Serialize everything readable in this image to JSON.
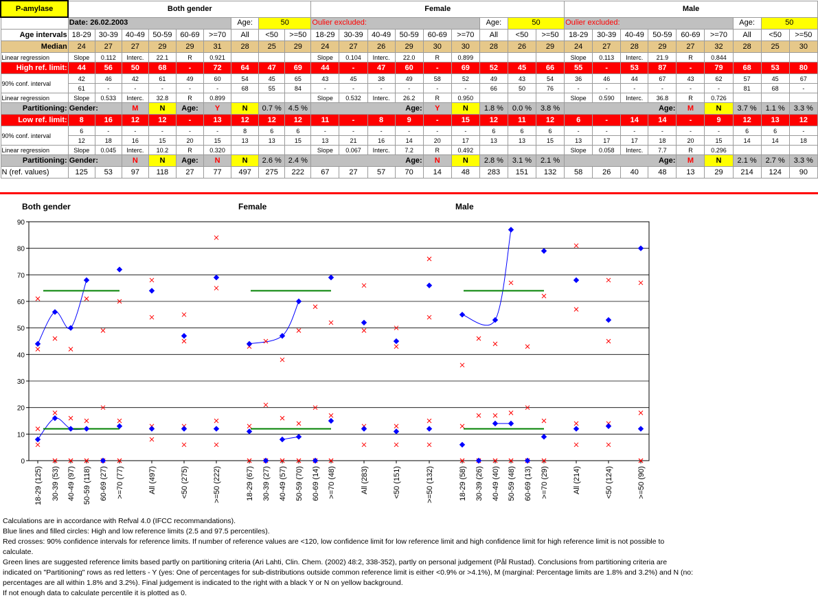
{
  "logo": "P-amylase",
  "date": "Date: 26.02.2003",
  "outlier": "Oulier excluded:",
  "age_label": "Age:",
  "age_value": "50",
  "sections": [
    "Both gender",
    "Female",
    "Male"
  ],
  "labels": {
    "age_intervals": "Age intervals",
    "median": "Median",
    "linreg": "Linear regression",
    "high": "High ref. limit:",
    "conf": "90% conf. interval",
    "low": "Low ref. limit:",
    "part": "Partitioning:",
    "gender": "Gender:",
    "age": "Age:",
    "n": "N (ref. values)"
  },
  "intervals": [
    "18-29",
    "30-39",
    "40-49",
    "50-59",
    "60-69",
    ">=70",
    "All",
    "<50",
    ">=50"
  ],
  "median": [
    [
      24,
      27,
      27,
      29,
      29,
      31,
      28,
      25,
      29
    ],
    [
      24,
      27,
      26,
      29,
      30,
      30,
      28,
      26,
      29
    ],
    [
      24,
      27,
      28,
      29,
      27,
      32,
      28,
      25,
      30
    ]
  ],
  "lr_high": [
    [
      "Slope",
      "0.112",
      "Interc.",
      "22.1",
      "R",
      "0.921"
    ],
    [
      "Slope",
      "0.104",
      "Interc.",
      "22.0",
      "R",
      "0.899"
    ],
    [
      "Slope",
      "0.113",
      "Interc.",
      "21.9",
      "R",
      "0.844"
    ]
  ],
  "high": [
    [
      "44",
      "56",
      "50",
      "68",
      "-",
      "72",
      "64",
      "47",
      "69"
    ],
    [
      "44",
      "-",
      "47",
      "60",
      "-",
      "69",
      "52",
      "45",
      "66"
    ],
    [
      "55",
      "-",
      "53",
      "87",
      "-",
      "79",
      "68",
      "53",
      "80"
    ]
  ],
  "high_ci_low": [
    [
      "42",
      "46",
      "42",
      "61",
      "49",
      "60",
      "54",
      "45",
      "65"
    ],
    [
      "43",
      "45",
      "38",
      "49",
      "58",
      "52",
      "49",
      "43",
      "54"
    ],
    [
      "36",
      "46",
      "44",
      "67",
      "43",
      "62",
      "57",
      "45",
      "67"
    ]
  ],
  "high_ci_high": [
    [
      "61",
      "-",
      "-",
      "-",
      "-",
      "-",
      "68",
      "55",
      "84"
    ],
    [
      "-",
      "-",
      "-",
      "-",
      "-",
      "-",
      "66",
      "50",
      "76"
    ],
    [
      "-",
      "-",
      "-",
      "-",
      "-",
      "-",
      "81",
      "68",
      "-"
    ]
  ],
  "lr_low": [
    [
      "Slope",
      "0.533",
      "Interc.",
      "32.8",
      "R",
      "0.899"
    ],
    [
      "Slope",
      "0.532",
      "Interc.",
      "26.2",
      "R",
      "0.950"
    ],
    [
      "Slope",
      "0.590",
      "Interc.",
      "36.8",
      "R",
      "0.726"
    ]
  ],
  "part_high": {
    "gender": [
      "M",
      "N"
    ],
    "age": [
      "Y",
      "N"
    ],
    "pct": [
      [
        "0.7 %",
        "4.5 %"
      ],
      [
        "1.8 %",
        "0.0 %",
        "3.8 %"
      ],
      [
        "3.7 %",
        "1.1 %",
        "3.3 %"
      ]
    ],
    "fem_age": [
      "Y",
      "N"
    ],
    "male_age": [
      "M",
      "N"
    ]
  },
  "low": [
    [
      "8",
      "16",
      "12",
      "12",
      "-",
      "13",
      "12",
      "12",
      "12"
    ],
    [
      "11",
      "-",
      "8",
      "9",
      "-",
      "15",
      "12",
      "11",
      "12"
    ],
    [
      "6",
      "-",
      "14",
      "14",
      "-",
      "9",
      "12",
      "13",
      "12"
    ]
  ],
  "low_ci_low": [
    [
      "6",
      "-",
      "-",
      "-",
      "-",
      "-",
      "8",
      "6",
      "6"
    ],
    [
      "-",
      "-",
      "-",
      "-",
      "-",
      "-",
      "6",
      "6",
      "6"
    ],
    [
      "-",
      "-",
      "-",
      "-",
      "-",
      "-",
      "6",
      "6",
      "-"
    ]
  ],
  "low_ci_high": [
    [
      "12",
      "18",
      "16",
      "15",
      "20",
      "15",
      "13",
      "13",
      "15"
    ],
    [
      "13",
      "21",
      "16",
      "14",
      "20",
      "17",
      "13",
      "13",
      "15"
    ],
    [
      "13",
      "17",
      "17",
      "18",
      "20",
      "15",
      "14",
      "14",
      "18"
    ]
  ],
  "lr_low2": [
    [
      "Slope",
      "0.045",
      "Interc.",
      "10.2",
      "R",
      "0.320"
    ],
    [
      "Slope",
      "0.067",
      "Interc.",
      "7.2",
      "R",
      "0.492"
    ],
    [
      "Slope",
      "0.058",
      "Interc.",
      "7.7",
      "R",
      "0.296"
    ]
  ],
  "part_low": {
    "gender": [
      "N",
      "N"
    ],
    "age": [
      "N",
      "N"
    ],
    "pct": [
      [
        "2.6 %",
        "2.4 %"
      ],
      [
        "2.8 %",
        "3.1 %",
        "2.1 %"
      ],
      [
        "2.1 %",
        "2.7 %",
        "3.3 %"
      ]
    ],
    "fem_age": [
      "N",
      "N"
    ],
    "male_age": [
      "M",
      "N"
    ]
  },
  "n": [
    [
      125,
      53,
      97,
      118,
      27,
      77,
      497,
      275,
      222
    ],
    [
      67,
      27,
      57,
      70,
      14,
      48,
      283,
      151,
      132
    ],
    [
      58,
      26,
      40,
      48,
      13,
      29,
      214,
      124,
      90
    ]
  ],
  "notes": [
    "Calculations are in accordance with Refval 4.0 (IFCC recommandations).",
    "Blue lines and filled circles: High and low reference limits (2.5 and 97.5 percentiles).",
    "Red crosses: 90% confidence intervals for reference limits. If number of reference values are <120, low confidence limit for low reference limit and high confidence limit for high reference limit is not possible to calculate.",
    "Green lines are suggested reference limits based partly on partitioning criteria (Ari Lahti, Clin. Chem. (2002) 48:2, 338-352), partly on personal judgement (Pål Rustad). Conclusions from partitioning criteria are indicated on \"Partitioning\" rows as red letters - Y (yes: One of percentages for sub-distributions outside common reference limit is either <0.9% or >4.1%), M (marginal: Percentage limits are 1.8% and 3.2%) and N (no:  percentages are all within 1.8% and 3.2%). Final judgement is indicated to the right with a black Y or N on yellow background.",
    "If not enough data to calculate percentile it is plotted as 0."
  ],
  "chart_data": {
    "type": "scatter",
    "title": "",
    "panel_titles": [
      "Both gender",
      "Female",
      "Male"
    ],
    "ylim": [
      0,
      90
    ],
    "yticks": [
      0,
      10,
      20,
      30,
      40,
      50,
      60,
      70,
      80,
      90
    ],
    "categories": [
      "18-29 (125)",
      "30-39 (53)",
      "40-49 (97)",
      "50-59 (118)",
      "60-69 (27)",
      ">=70 (77)",
      "All (497)",
      "<50 (275)",
      ">=50 (222)",
      "18-29 (67)",
      "30-39 (27)",
      "40-49 (57)",
      "50-59 (70)",
      "60-69 (14)",
      ">=70 (48)",
      "All (283)",
      "<50 (151)",
      ">=50 (132)",
      "18-29 (58)",
      "30-39 (26)",
      "40-49 (40)",
      "50-59 (48)",
      "60-69 (13)",
      ">=70 (29)",
      "All (214)",
      "<50 (124)",
      ">=50 (90)"
    ],
    "series": [
      {
        "name": "High ref. limit",
        "values": [
          44,
          56,
          50,
          68,
          0,
          72,
          64,
          47,
          69,
          44,
          0,
          47,
          60,
          0,
          69,
          52,
          45,
          66,
          55,
          0,
          53,
          87,
          0,
          79,
          68,
          53,
          80
        ]
      },
      {
        "name": "Low ref. limit",
        "values": [
          8,
          16,
          12,
          12,
          0,
          13,
          12,
          12,
          12,
          11,
          0,
          8,
          9,
          0,
          15,
          12,
          11,
          12,
          6,
          0,
          14,
          14,
          0,
          9,
          12,
          13,
          12
        ]
      },
      {
        "name": "High CI low",
        "values": [
          42,
          46,
          42,
          61,
          49,
          60,
          54,
          45,
          65,
          43,
          45,
          38,
          49,
          58,
          52,
          49,
          43,
          54,
          36,
          46,
          44,
          67,
          43,
          62,
          57,
          45,
          67
        ]
      },
      {
        "name": "High CI high",
        "values": [
          61,
          0,
          0,
          0,
          0,
          0,
          68,
          55,
          84,
          0,
          0,
          0,
          0,
          0,
          0,
          66,
          50,
          76,
          0,
          0,
          0,
          0,
          0,
          0,
          81,
          68,
          0
        ]
      },
      {
        "name": "Low CI low",
        "values": [
          6,
          0,
          0,
          0,
          0,
          0,
          8,
          6,
          6,
          0,
          0,
          0,
          0,
          0,
          0,
          6,
          6,
          6,
          0,
          0,
          0,
          0,
          0,
          0,
          6,
          6,
          0
        ]
      },
      {
        "name": "Low CI high",
        "values": [
          12,
          18,
          16,
          15,
          20,
          15,
          13,
          13,
          15,
          13,
          21,
          16,
          14,
          20,
          17,
          13,
          13,
          15,
          13,
          17,
          17,
          18,
          20,
          15,
          14,
          14,
          18
        ]
      }
    ],
    "suggested_limits": [
      {
        "group": "Both gender",
        "high": 64,
        "low": 12
      },
      {
        "group": "Female",
        "high": 64,
        "low": 12
      },
      {
        "group": "Male",
        "high": 64,
        "low": 12
      }
    ],
    "colors": {
      "limit": "#0000ff",
      "ci": "#ff0000",
      "suggested": "#008000"
    }
  }
}
